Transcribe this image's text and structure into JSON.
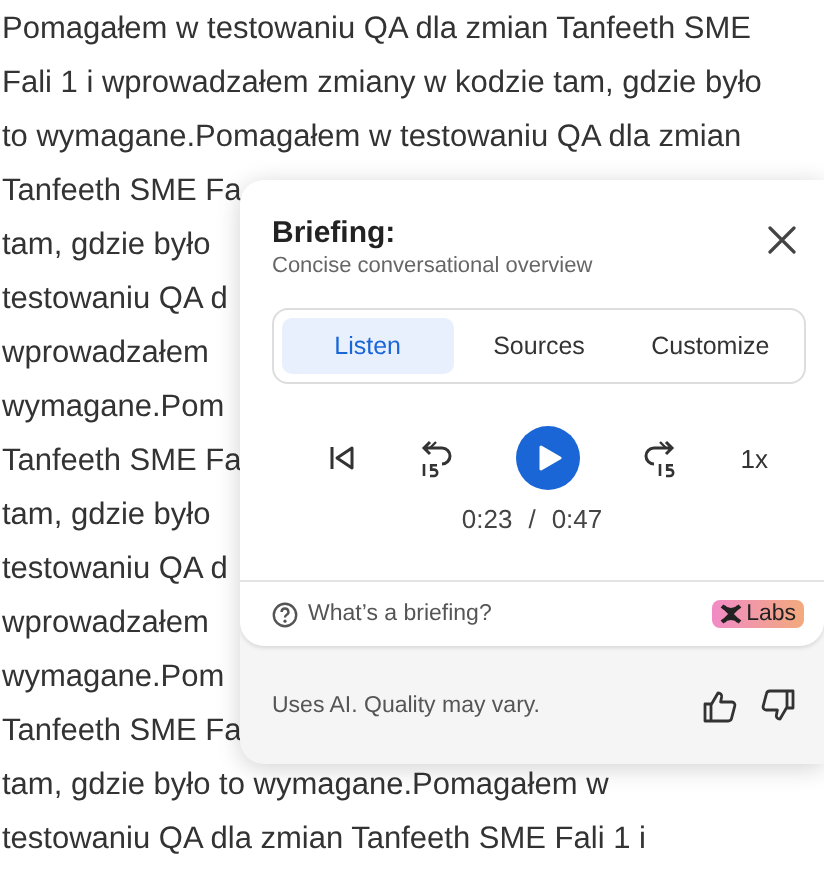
{
  "document": {
    "lines": [
      "Pomagałem w testowaniu QA dla zmian Tanfeeth SME",
      "Fali 1 i wprowadzałem zmiany w kodzie tam, gdzie było",
      "to wymagane.Pomagałem w testowaniu QA dla zmian",
      "Tanfeeth SME Fa",
      "tam, gdzie było",
      "testowaniu QA d",
      "wprowadzałem",
      "wymagane.Pom",
      "Tanfeeth SME Fa",
      "tam, gdzie było",
      "testowaniu QA d",
      "wprowadzałem",
      "wymagane.Pom",
      "Tanfeeth SME Fa",
      "tam, gdzie było to wymagane.Pomagałem w",
      "testowaniu QA dla zmian Tanfeeth SME Fali 1 i"
    ]
  },
  "popup": {
    "title": "Briefing:",
    "subtitle": "Concise conversational overview",
    "tabs": [
      {
        "label": "Listen",
        "selected": true
      },
      {
        "label": "Sources",
        "selected": false
      },
      {
        "label": "Customize",
        "selected": false
      }
    ],
    "player": {
      "playing": false,
      "speed": "1x",
      "current_time": "0:23",
      "separator": "/",
      "total_time": "0:47"
    },
    "help_link": "What’s a briefing?",
    "badge": "Labs",
    "disclaimer": "Uses AI. Quality may vary."
  }
}
